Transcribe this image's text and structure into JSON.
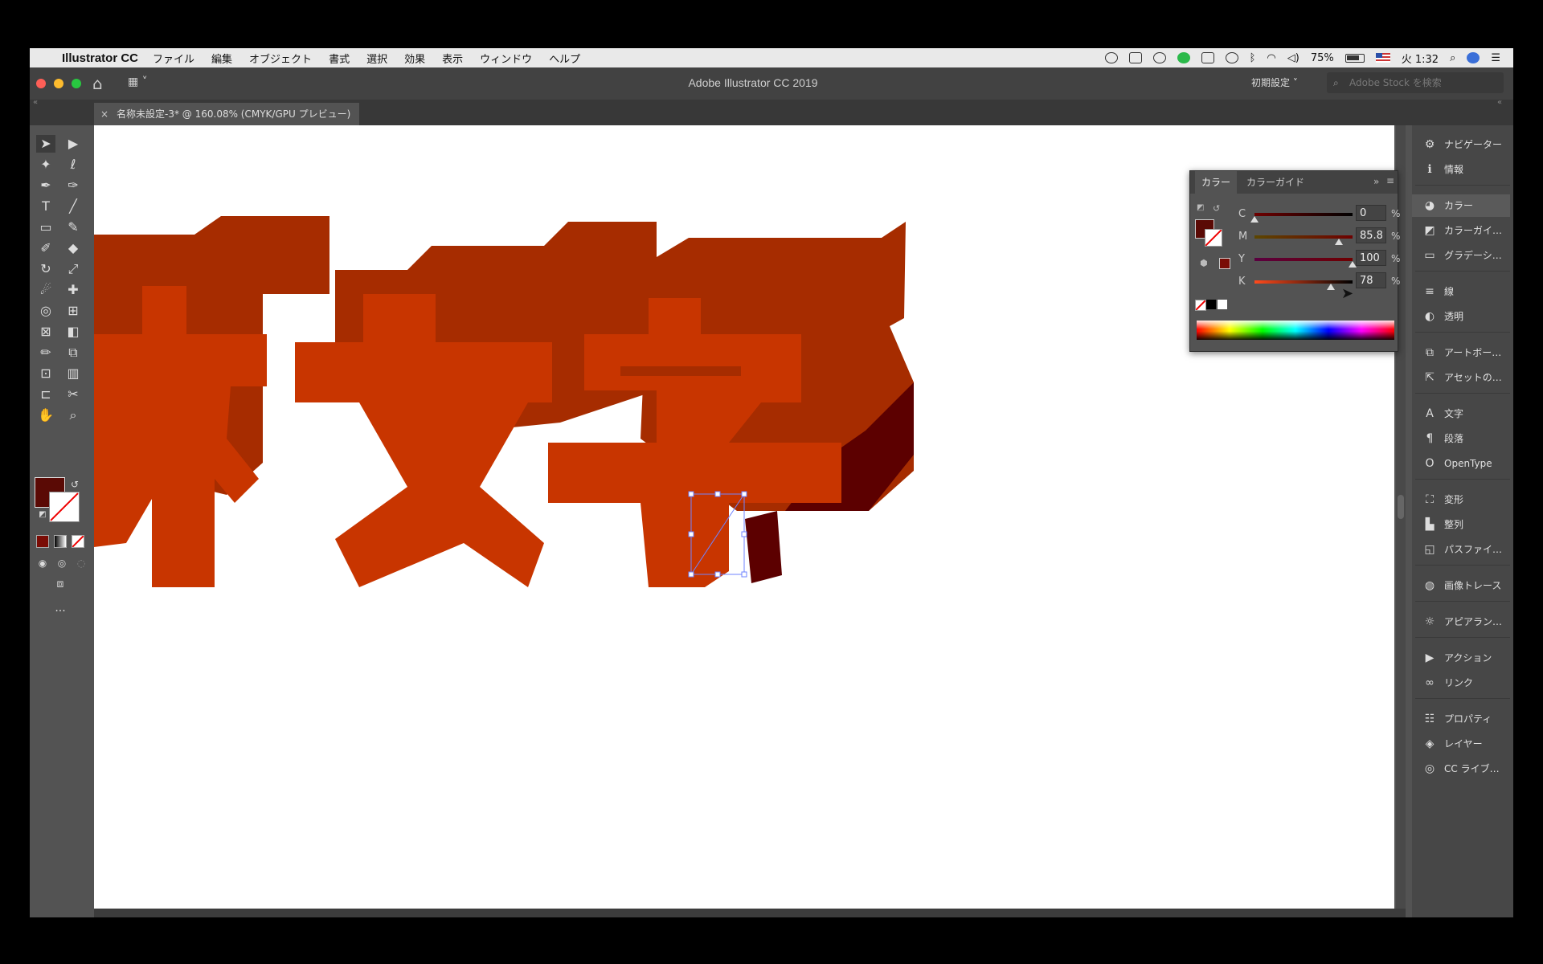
{
  "menubar": {
    "app_name": "Illustrator CC",
    "menus": [
      "ファイル",
      "編集",
      "オブジェクト",
      "書式",
      "選択",
      "効果",
      "表示",
      "ウィンドウ",
      "ヘルプ"
    ],
    "battery": "75%",
    "clock": "火 1:32"
  },
  "titlebar": {
    "title": "Adobe Illustrator CC 2019",
    "workspace": "初期設定",
    "stock_placeholder": "Adobe Stock を検索"
  },
  "document_tab": {
    "close": "×",
    "label": "名称未設定-3* @ 160.08% (CMYK/GPU プレビュー)"
  },
  "artwork": {
    "fill_color": "#c83500",
    "side_color": "#a62c00",
    "dark_side_color": "#5c0000"
  },
  "color_panel": {
    "tabs": [
      "カラー",
      "カラーガイド"
    ],
    "channels": [
      {
        "label": "C",
        "value": "0",
        "unit": "%",
        "fraction": 0.0
      },
      {
        "label": "M",
        "value": "85.8",
        "unit": "%",
        "fraction": 0.858
      },
      {
        "label": "Y",
        "value": "100",
        "unit": "%",
        "fraction": 1.0
      },
      {
        "label": "K",
        "value": "78",
        "unit": "%",
        "fraction": 0.78
      }
    ],
    "fill_swatch": "#5a0a05"
  },
  "dock": {
    "items": [
      {
        "icon": "navigator-icon",
        "glyph": "⚙",
        "label": "ナビゲーター"
      },
      {
        "icon": "info-icon",
        "glyph": "ℹ",
        "label": "情報"
      },
      {
        "icon": "color-icon",
        "glyph": "◕",
        "label": "カラー"
      },
      {
        "icon": "color-guide-icon",
        "glyph": "◩",
        "label": "カラーガイ…"
      },
      {
        "icon": "gradient-icon",
        "glyph": "▭",
        "label": "グラデーシ…"
      },
      {
        "icon": "stroke-icon",
        "glyph": "≡",
        "label": "線"
      },
      {
        "icon": "transparency-icon",
        "glyph": "◐",
        "label": "透明"
      },
      {
        "icon": "artboards-icon",
        "glyph": "⧉",
        "label": "アートボー…"
      },
      {
        "icon": "asset-export-icon",
        "glyph": "⇱",
        "label": "アセットの…"
      },
      {
        "icon": "character-icon",
        "glyph": "A",
        "label": "文字"
      },
      {
        "icon": "paragraph-icon",
        "glyph": "¶",
        "label": "段落"
      },
      {
        "icon": "opentype-icon",
        "glyph": "O",
        "label": "OpenType"
      },
      {
        "icon": "transform-icon",
        "glyph": "⛶",
        "label": "変形"
      },
      {
        "icon": "align-icon",
        "glyph": "▙",
        "label": "整列"
      },
      {
        "icon": "pathfinder-icon",
        "glyph": "◱",
        "label": "パスファイ…"
      },
      {
        "icon": "image-trace-icon",
        "glyph": "◍",
        "label": "画像トレース"
      },
      {
        "icon": "appearance-icon",
        "glyph": "☼",
        "label": "アピアラン…"
      },
      {
        "icon": "actions-icon",
        "glyph": "▶",
        "label": "アクション"
      },
      {
        "icon": "links-icon",
        "glyph": "∞",
        "label": "リンク"
      },
      {
        "icon": "properties-icon",
        "glyph": "☷",
        "label": "プロパティ"
      },
      {
        "icon": "layers-icon",
        "glyph": "◈",
        "label": "レイヤー"
      },
      {
        "icon": "cc-libraries-icon",
        "glyph": "◎",
        "label": "CC ライブ…"
      }
    ]
  }
}
